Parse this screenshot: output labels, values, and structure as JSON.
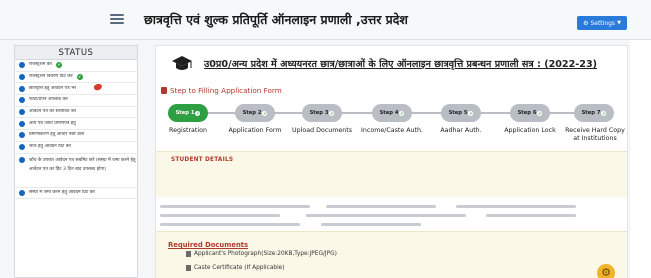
{
  "header": {
    "title": "छात्रवृत्ति एवं शुल्क प्रतिपूर्ति ऑनलाइन प्रणाली ,उत्तर प्रदेश",
    "settings_label": "Settings",
    "accent": "#2a7ad9"
  },
  "sidebar": {
    "heading": "STATUS",
    "items": [
      {
        "label": "रजिस्ट्रेशन करें",
        "done": true
      },
      {
        "label": "रजिस्ट्रेशन विवरण प्रिंट करें",
        "done": true
      },
      {
        "label": "छात्रवृत्ति हेतु आवेदन पत्र भरें",
        "done": false
      },
      {
        "label": "फोटो/प्रपत्र अपलोड करें",
        "done": false
      },
      {
        "label": "आवेदन पत्र को संशोधित करें",
        "done": false
      },
      {
        "label": "आय एवं जाति प्रमाणपत्र हेतु",
        "done": false
      },
      {
        "label": "प्रमाणीकरण हेतु आधार नंबर डालें",
        "done": false
      },
      {
        "label": "जाँच हेतु आवेदन प्रिंट करें",
        "done": false
      },
      {
        "label": "जाँच के उपरांत आवेदन पत्र सबमिट करें (संस्था में जमा करने हेतु आवेदन पत्र का प्रिंट 3 दिन बाद उपलब्ध होगा)",
        "done": false
      },
      {
        "label": "संस्था में जमा करने हेतु आवेदन प्रिंट करें",
        "done": false
      }
    ]
  },
  "main": {
    "scheme_title": "उ0प्र0/अन्य प्रदेश में अध्ययनरत छात्र/छात्राओं के लिए ऑनलाइन छात्रवृत्ति प्रबन्धन प्रणाली सत्र : (2022-23)",
    "step_heading": "Step to Filling Application Form",
    "steps": [
      {
        "badge": "Step 1",
        "label": "Registration",
        "active": true
      },
      {
        "badge": "Step 2",
        "label": "Application Form",
        "active": false
      },
      {
        "badge": "Step 3",
        "label": "Upload Documents",
        "active": false
      },
      {
        "badge": "Step 4",
        "label": "Income/Caste Auth.",
        "active": false
      },
      {
        "badge": "Step 5",
        "label": "Aadhar Auth.",
        "active": false
      },
      {
        "badge": "Step 6",
        "label": "Application Lock",
        "active": false
      },
      {
        "badge": "Step 7",
        "label": "Receive Hard Copy at Institutions",
        "active": false
      }
    ],
    "student_details_title": "STUDENT DETAILS",
    "required_documents_title": "Required Documents",
    "documents": [
      "Applicant's Photograph(Size:20KB,Type:JPEG/JPG)",
      "Caste Certificate (If Applicable)"
    ]
  },
  "colors": {
    "step_active": "#2ea043",
    "step_inactive": "#b9bec4",
    "section_heading": "#b03a2e",
    "sidebar_bullet": "#1565c0",
    "done_check": "#2e9e3f"
  }
}
